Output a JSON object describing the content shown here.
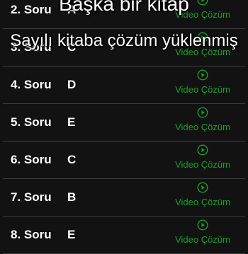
{
  "overlay": {
    "line1": "Başka bir kitap",
    "line2": "Sayılı kitaba çözüm yüklenmiş"
  },
  "questions": [
    {
      "label": "2. Soru",
      "answer": "A",
      "video_label": "Video Çözüm"
    },
    {
      "label": "3. Soru",
      "answer": "C",
      "video_label": "Video Çözüm"
    },
    {
      "label": "4. Soru",
      "answer": "D",
      "video_label": "Video Çözüm"
    },
    {
      "label": "5. Soru",
      "answer": "E",
      "video_label": "Video Çözüm"
    },
    {
      "label": "6. Soru",
      "answer": "C",
      "video_label": "Video Çözüm"
    },
    {
      "label": "7. Soru",
      "answer": "B",
      "video_label": "Video Çözüm"
    },
    {
      "label": "8. Soru",
      "answer": "E",
      "video_label": "Video Çözüm"
    }
  ],
  "colors": {
    "background": "#121212",
    "divider": "#3c3c3c",
    "accent_green": "#1a9e2a",
    "text": "#ffffff"
  },
  "icons": {
    "video": "play-circle-icon"
  }
}
